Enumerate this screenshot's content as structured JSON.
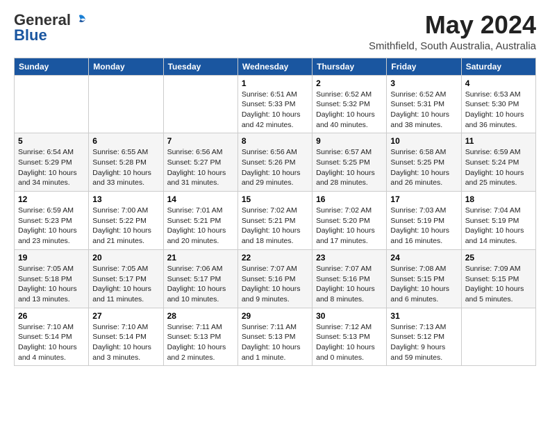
{
  "header": {
    "logo_general": "General",
    "logo_blue": "Blue",
    "title": "May 2024",
    "subtitle": "Smithfield, South Australia, Australia"
  },
  "columns": [
    "Sunday",
    "Monday",
    "Tuesday",
    "Wednesday",
    "Thursday",
    "Friday",
    "Saturday"
  ],
  "weeks": [
    [
      {
        "day": "",
        "text": ""
      },
      {
        "day": "",
        "text": ""
      },
      {
        "day": "",
        "text": ""
      },
      {
        "day": "1",
        "text": "Sunrise: 6:51 AM\nSunset: 5:33 PM\nDaylight: 10 hours\nand 42 minutes."
      },
      {
        "day": "2",
        "text": "Sunrise: 6:52 AM\nSunset: 5:32 PM\nDaylight: 10 hours\nand 40 minutes."
      },
      {
        "day": "3",
        "text": "Sunrise: 6:52 AM\nSunset: 5:31 PM\nDaylight: 10 hours\nand 38 minutes."
      },
      {
        "day": "4",
        "text": "Sunrise: 6:53 AM\nSunset: 5:30 PM\nDaylight: 10 hours\nand 36 minutes."
      }
    ],
    [
      {
        "day": "5",
        "text": "Sunrise: 6:54 AM\nSunset: 5:29 PM\nDaylight: 10 hours\nand 34 minutes."
      },
      {
        "day": "6",
        "text": "Sunrise: 6:55 AM\nSunset: 5:28 PM\nDaylight: 10 hours\nand 33 minutes."
      },
      {
        "day": "7",
        "text": "Sunrise: 6:56 AM\nSunset: 5:27 PM\nDaylight: 10 hours\nand 31 minutes."
      },
      {
        "day": "8",
        "text": "Sunrise: 6:56 AM\nSunset: 5:26 PM\nDaylight: 10 hours\nand 29 minutes."
      },
      {
        "day": "9",
        "text": "Sunrise: 6:57 AM\nSunset: 5:25 PM\nDaylight: 10 hours\nand 28 minutes."
      },
      {
        "day": "10",
        "text": "Sunrise: 6:58 AM\nSunset: 5:25 PM\nDaylight: 10 hours\nand 26 minutes."
      },
      {
        "day": "11",
        "text": "Sunrise: 6:59 AM\nSunset: 5:24 PM\nDaylight: 10 hours\nand 25 minutes."
      }
    ],
    [
      {
        "day": "12",
        "text": "Sunrise: 6:59 AM\nSunset: 5:23 PM\nDaylight: 10 hours\nand 23 minutes."
      },
      {
        "day": "13",
        "text": "Sunrise: 7:00 AM\nSunset: 5:22 PM\nDaylight: 10 hours\nand 21 minutes."
      },
      {
        "day": "14",
        "text": "Sunrise: 7:01 AM\nSunset: 5:21 PM\nDaylight: 10 hours\nand 20 minutes."
      },
      {
        "day": "15",
        "text": "Sunrise: 7:02 AM\nSunset: 5:21 PM\nDaylight: 10 hours\nand 18 minutes."
      },
      {
        "day": "16",
        "text": "Sunrise: 7:02 AM\nSunset: 5:20 PM\nDaylight: 10 hours\nand 17 minutes."
      },
      {
        "day": "17",
        "text": "Sunrise: 7:03 AM\nSunset: 5:19 PM\nDaylight: 10 hours\nand 16 minutes."
      },
      {
        "day": "18",
        "text": "Sunrise: 7:04 AM\nSunset: 5:19 PM\nDaylight: 10 hours\nand 14 minutes."
      }
    ],
    [
      {
        "day": "19",
        "text": "Sunrise: 7:05 AM\nSunset: 5:18 PM\nDaylight: 10 hours\nand 13 minutes."
      },
      {
        "day": "20",
        "text": "Sunrise: 7:05 AM\nSunset: 5:17 PM\nDaylight: 10 hours\nand 11 minutes."
      },
      {
        "day": "21",
        "text": "Sunrise: 7:06 AM\nSunset: 5:17 PM\nDaylight: 10 hours\nand 10 minutes."
      },
      {
        "day": "22",
        "text": "Sunrise: 7:07 AM\nSunset: 5:16 PM\nDaylight: 10 hours\nand 9 minutes."
      },
      {
        "day": "23",
        "text": "Sunrise: 7:07 AM\nSunset: 5:16 PM\nDaylight: 10 hours\nand 8 minutes."
      },
      {
        "day": "24",
        "text": "Sunrise: 7:08 AM\nSunset: 5:15 PM\nDaylight: 10 hours\nand 6 minutes."
      },
      {
        "day": "25",
        "text": "Sunrise: 7:09 AM\nSunset: 5:15 PM\nDaylight: 10 hours\nand 5 minutes."
      }
    ],
    [
      {
        "day": "26",
        "text": "Sunrise: 7:10 AM\nSunset: 5:14 PM\nDaylight: 10 hours\nand 4 minutes."
      },
      {
        "day": "27",
        "text": "Sunrise: 7:10 AM\nSunset: 5:14 PM\nDaylight: 10 hours\nand 3 minutes."
      },
      {
        "day": "28",
        "text": "Sunrise: 7:11 AM\nSunset: 5:13 PM\nDaylight: 10 hours\nand 2 minutes."
      },
      {
        "day": "29",
        "text": "Sunrise: 7:11 AM\nSunset: 5:13 PM\nDaylight: 10 hours\nand 1 minute."
      },
      {
        "day": "30",
        "text": "Sunrise: 7:12 AM\nSunset: 5:13 PM\nDaylight: 10 hours\nand 0 minutes."
      },
      {
        "day": "31",
        "text": "Sunrise: 7:13 AM\nSunset: 5:12 PM\nDaylight: 9 hours\nand 59 minutes."
      },
      {
        "day": "",
        "text": ""
      }
    ]
  ]
}
